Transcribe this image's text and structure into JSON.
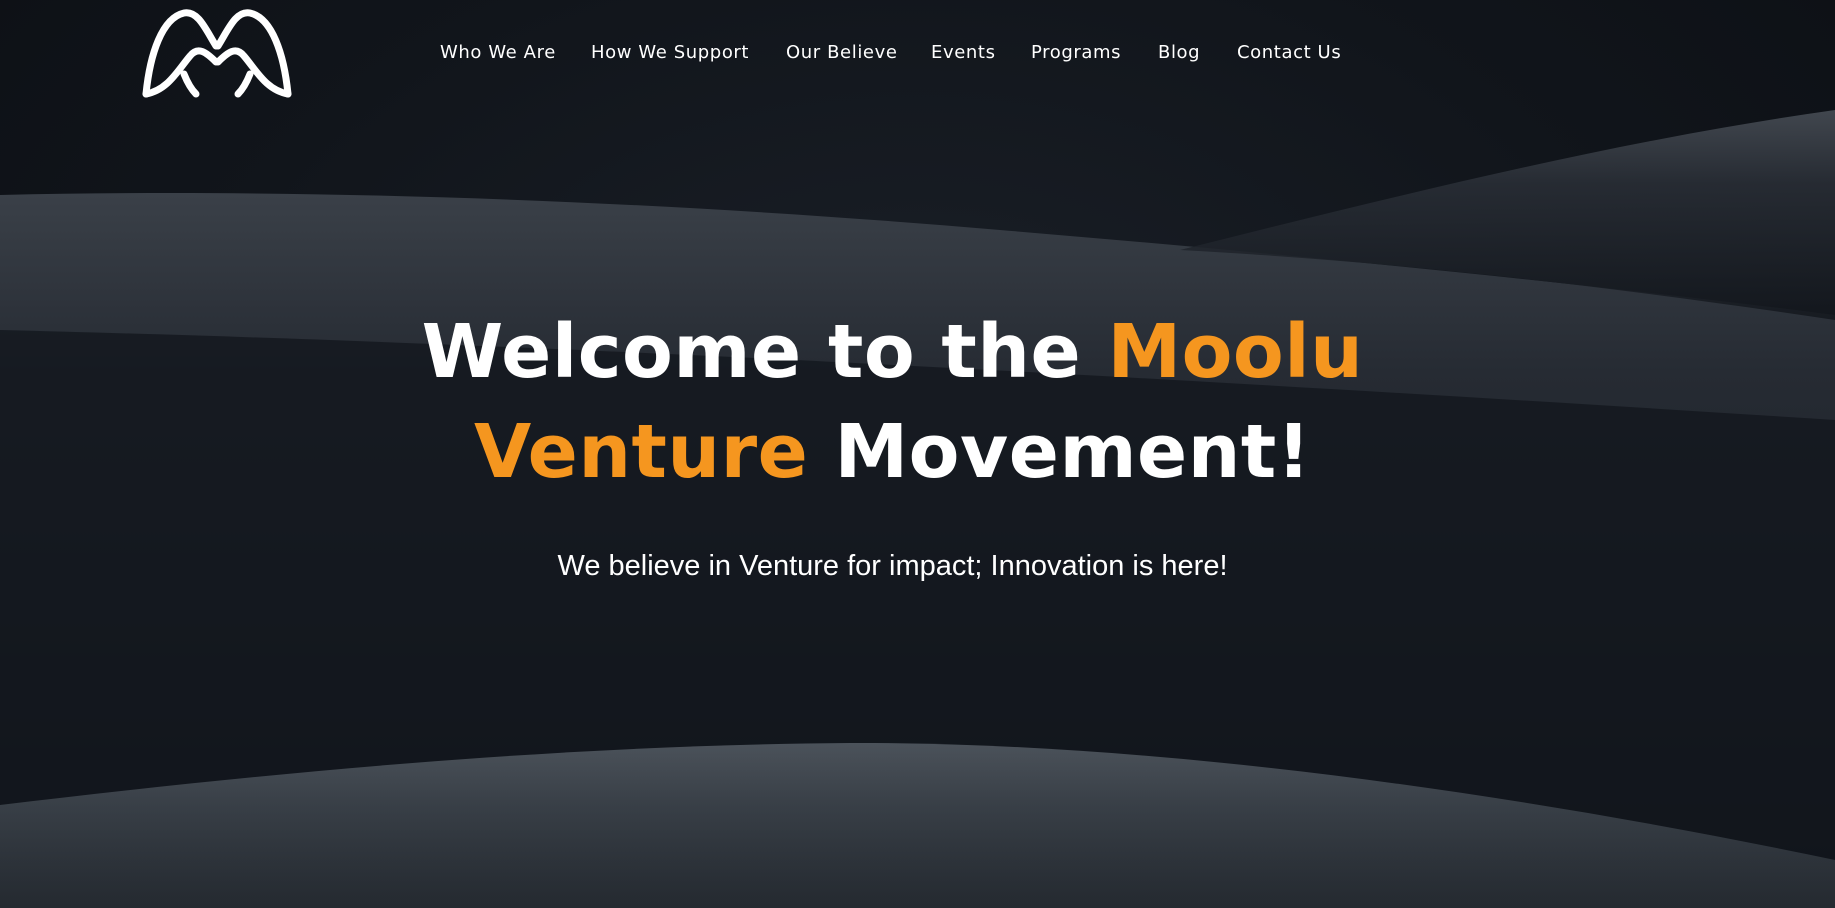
{
  "nav": {
    "items": [
      {
        "label": "Who We Are"
      },
      {
        "label": "How We Support"
      },
      {
        "label": "Our Believe"
      },
      {
        "label": "Events"
      },
      {
        "label": "Programs"
      },
      {
        "label": "Blog"
      },
      {
        "label": "Contact Us"
      }
    ]
  },
  "hero": {
    "headline": {
      "line1_white": "Welcome to the ",
      "line1_accent": "Moolu",
      "line2_accent": "Venture",
      "line2_white": " Movement!"
    },
    "tagline": "We believe in Venture for impact; Innovation is here!"
  },
  "colors": {
    "accent": "#f5961f",
    "background": "#12161c",
    "text": "#ffffff"
  },
  "icons": {
    "logo": "moolu-wings-logo"
  }
}
